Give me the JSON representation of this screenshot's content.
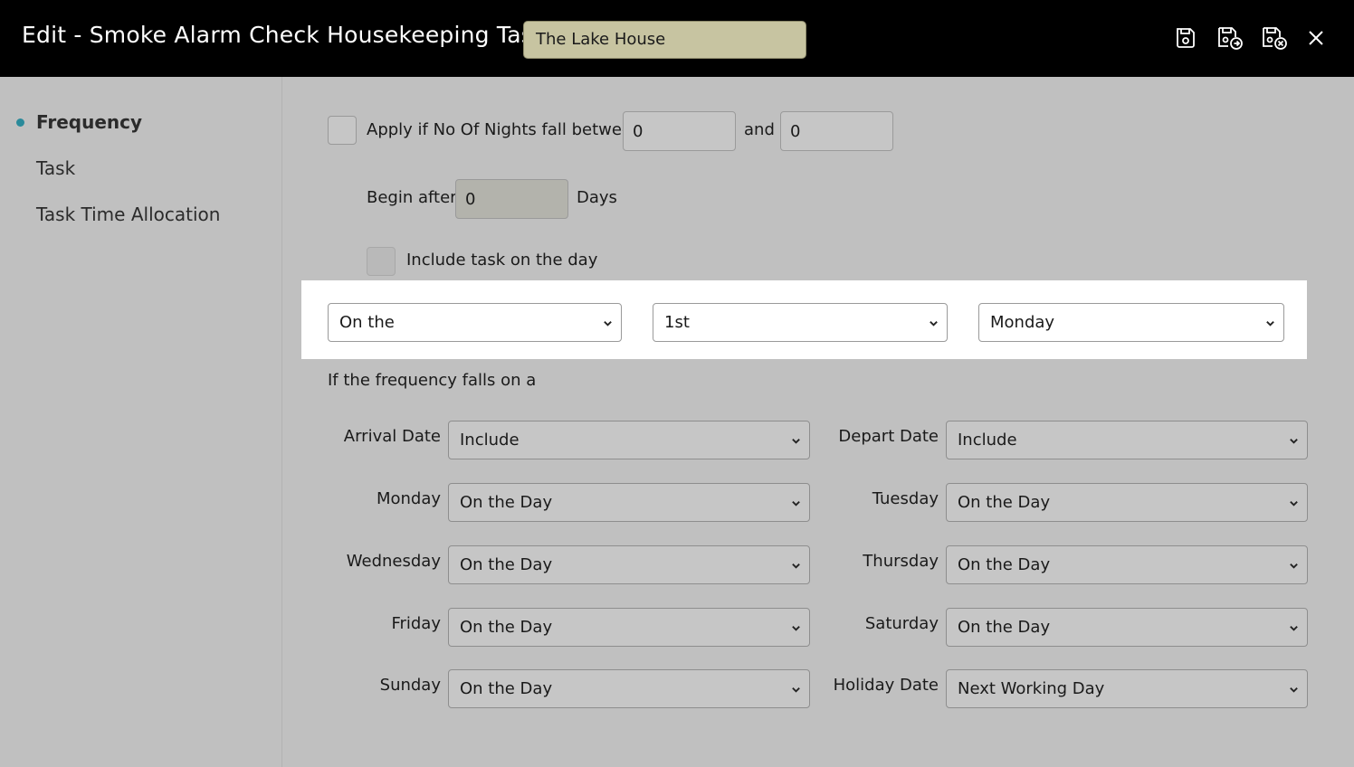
{
  "header": {
    "title": "Edit - Smoke Alarm Check Housekeeping Task",
    "property": "The Lake House",
    "actions": {
      "save_icon": "save-icon",
      "save_exit_icon": "save-and-exit-icon",
      "cancel_icon": "cancel-icon",
      "close_icon": "close-icon"
    }
  },
  "sidebar": {
    "items": [
      {
        "label": "Frequency",
        "active": true
      },
      {
        "label": "Task",
        "active": false
      },
      {
        "label": "Task Time Allocation",
        "active": false
      }
    ],
    "accent": "#2a8a9a"
  },
  "nights": {
    "label": "Apply if No Of Nights fall between",
    "from": "0",
    "and_label": "and",
    "to": "0"
  },
  "begin": {
    "label": "Begin after",
    "value": "0",
    "unit": "Days"
  },
  "include_task": {
    "label": "Include task on the day"
  },
  "frequency_pattern": {
    "mode": "On the",
    "occurrence": "1st",
    "weekday": "Monday"
  },
  "falls_on": {
    "heading": "If the frequency falls on a",
    "arrival": {
      "label": "Arrival Date",
      "value": "Include"
    },
    "depart": {
      "label": "Depart Date",
      "value": "Include"
    },
    "monday": {
      "label": "Monday",
      "value": "On the Day"
    },
    "tuesday": {
      "label": "Tuesday",
      "value": "On the Day"
    },
    "wednesday": {
      "label": "Wednesday",
      "value": "On the Day"
    },
    "thursday": {
      "label": "Thursday",
      "value": "On the Day"
    },
    "friday": {
      "label": "Friday",
      "value": "On the Day"
    },
    "saturday": {
      "label": "Saturday",
      "value": "On the Day"
    },
    "sunday": {
      "label": "Sunday",
      "value": "On the Day"
    },
    "holiday": {
      "label": "Holiday Date",
      "value": "Next Working Day"
    }
  }
}
